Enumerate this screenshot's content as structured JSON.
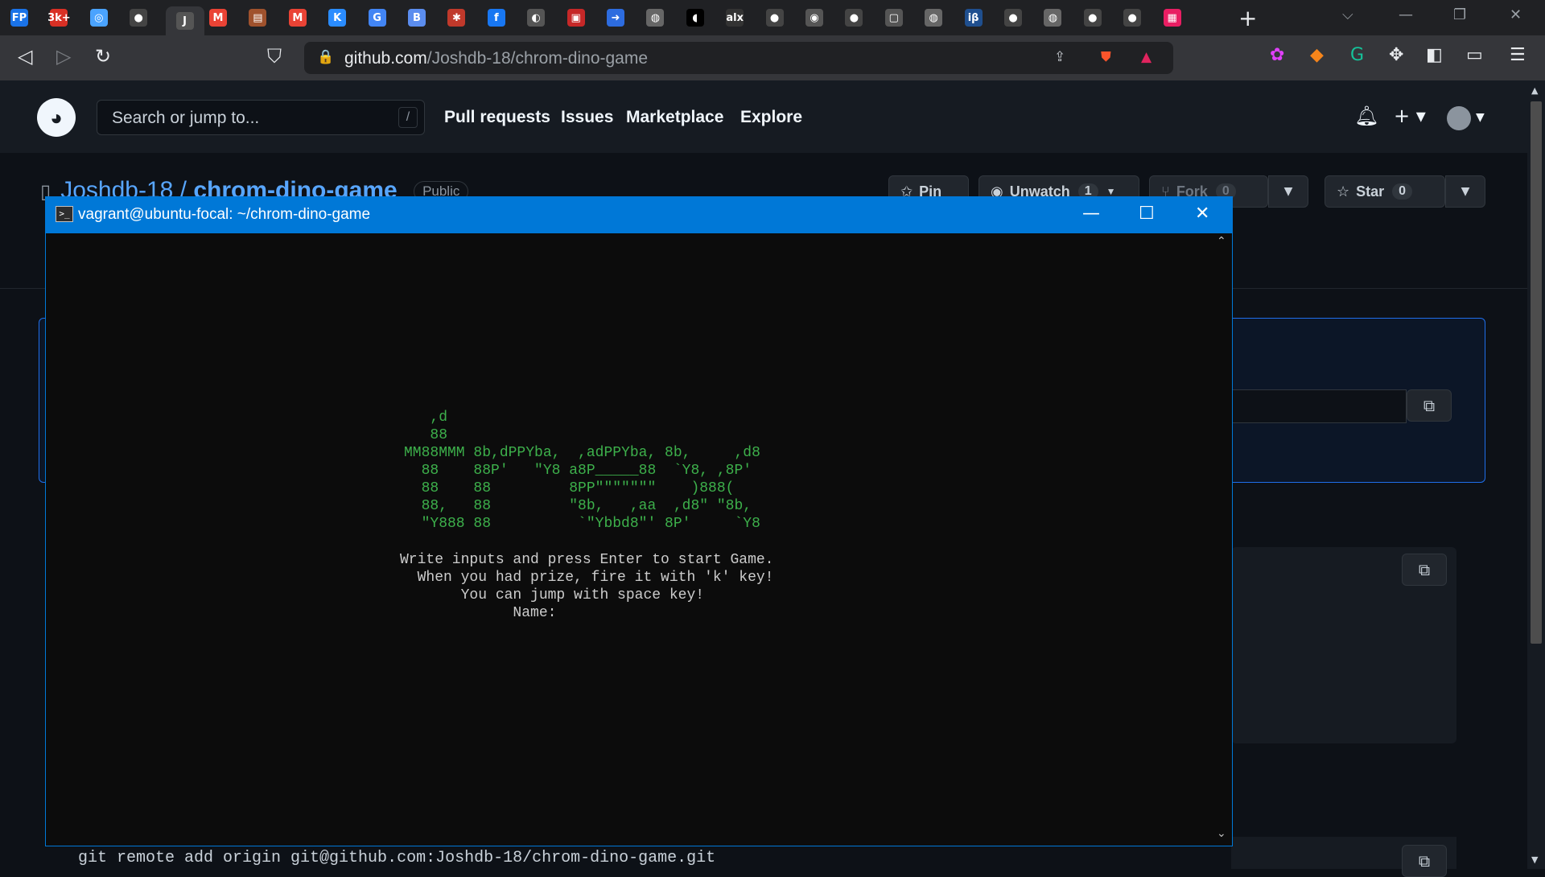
{
  "browser": {
    "tab_favicons": [
      {
        "icon": "fp-icon",
        "text": "FP",
        "color": "#1a73e8"
      },
      {
        "icon": "badge-icon",
        "text": "3k+",
        "color": "#d93025"
      },
      {
        "icon": "chat-icon",
        "text": "◎",
        "color": "#4aa3ff"
      },
      {
        "icon": "github-icon",
        "text": "●",
        "color": "#444"
      },
      {
        "icon": "doc-icon",
        "text": "J",
        "color": "#555"
      },
      {
        "icon": "gmail-icon",
        "text": "M",
        "color": "#ea4335"
      },
      {
        "icon": "news-icon",
        "text": "▤",
        "color": "#a0522d"
      },
      {
        "icon": "gmail-icon",
        "text": "M",
        "color": "#ea4335"
      },
      {
        "icon": "k-icon",
        "text": "K",
        "color": "#2a8cff"
      },
      {
        "icon": "google-icon",
        "text": "G",
        "color": "#4285f4"
      },
      {
        "icon": "b-icon",
        "text": "B",
        "color": "#5b8def"
      },
      {
        "icon": "tree-icon",
        "text": "✱",
        "color": "#c0392b"
      },
      {
        "icon": "facebook-icon",
        "text": "f",
        "color": "#1877f2"
      },
      {
        "icon": "globe-icon",
        "text": "◐",
        "color": "#555"
      },
      {
        "icon": "gift-icon",
        "text": "▣",
        "color": "#c62828"
      },
      {
        "icon": "arrow-icon",
        "text": "➜",
        "color": "#2d6cdf"
      },
      {
        "icon": "globe-icon",
        "text": "◍",
        "color": "#666"
      },
      {
        "icon": "dark-icon",
        "text": "◖",
        "color": "#000"
      },
      {
        "icon": "alx-icon",
        "text": "alx",
        "color": "#333"
      },
      {
        "icon": "github-icon",
        "text": "●",
        "color": "#444"
      },
      {
        "icon": "circle-icon",
        "text": "◉",
        "color": "#555"
      },
      {
        "icon": "github-icon",
        "text": "●",
        "color": "#444"
      },
      {
        "icon": "box-icon",
        "text": "▢",
        "color": "#555"
      },
      {
        "icon": "globe-icon",
        "text": "◍",
        "color": "#666"
      },
      {
        "icon": "ib-icon",
        "text": "iβ",
        "color": "#1f4f8f"
      },
      {
        "icon": "github-icon",
        "text": "●",
        "color": "#444"
      },
      {
        "icon": "globe-icon",
        "text": "◍",
        "color": "#666"
      },
      {
        "icon": "github-icon",
        "text": "●",
        "color": "#444"
      },
      {
        "icon": "github-icon",
        "text": "●",
        "color": "#444"
      },
      {
        "icon": "grid-icon",
        "text": "▦",
        "color": "#e91e63"
      }
    ],
    "tab_close": "✕",
    "new_tab": "+",
    "url_host": "github.com",
    "url_path": "/Joshdb-18/chrom-dino-game",
    "back_icon": "◁",
    "forward_icon": "▷",
    "reload_icon": "↻",
    "bookmark_icon": "⛉",
    "lock_icon": "🔒",
    "share_icon": "⇪"
  },
  "github": {
    "search_placeholder": "Search or jump to...",
    "search_shortcut": "/",
    "nav": [
      "Pull requests",
      "Issues",
      "Marketplace",
      "Explore"
    ],
    "repo_owner": "Joshdb-18",
    "repo_separator": "/",
    "repo_name": "chrom-dino-game",
    "visibility": "Public",
    "pin_label": "Pin",
    "watch_label": "Unwatch",
    "watch_count": "1",
    "fork_label": "Fork",
    "fork_count": "0",
    "star_label": "Star",
    "star_count": "0",
    "bottom_command": "git remote add origin git@github.com:Joshdb-18/chrom-dino-game.git"
  },
  "terminal": {
    "title": "vagrant@ubuntu-focal: ~/chrom-dino-game",
    "minimize": "—",
    "maximize": "☐",
    "close": "✕",
    "ascii_art": "   ,d\n   88\nMM88MMM 8b,dPPYba,  ,adPPYba, 8b,     ,d8\n  88    88P'   \"Y8 a8P_____88  `Y8, ,8P'\n  88    88         8PP\"\"\"\"\"\"\"    )888(\n  88,   88         \"8b,   ,aa  ,d8\" \"8b,\n  \"Y888 88          `\"Ybbd8\"' 8P'     `Y8",
    "messages": "Write inputs and press Enter to start Game.\n  When you had prize, fire it with 'k' key!\n       You can jump with space key!\n             Name:",
    "ascii_color": "#3db04b"
  }
}
